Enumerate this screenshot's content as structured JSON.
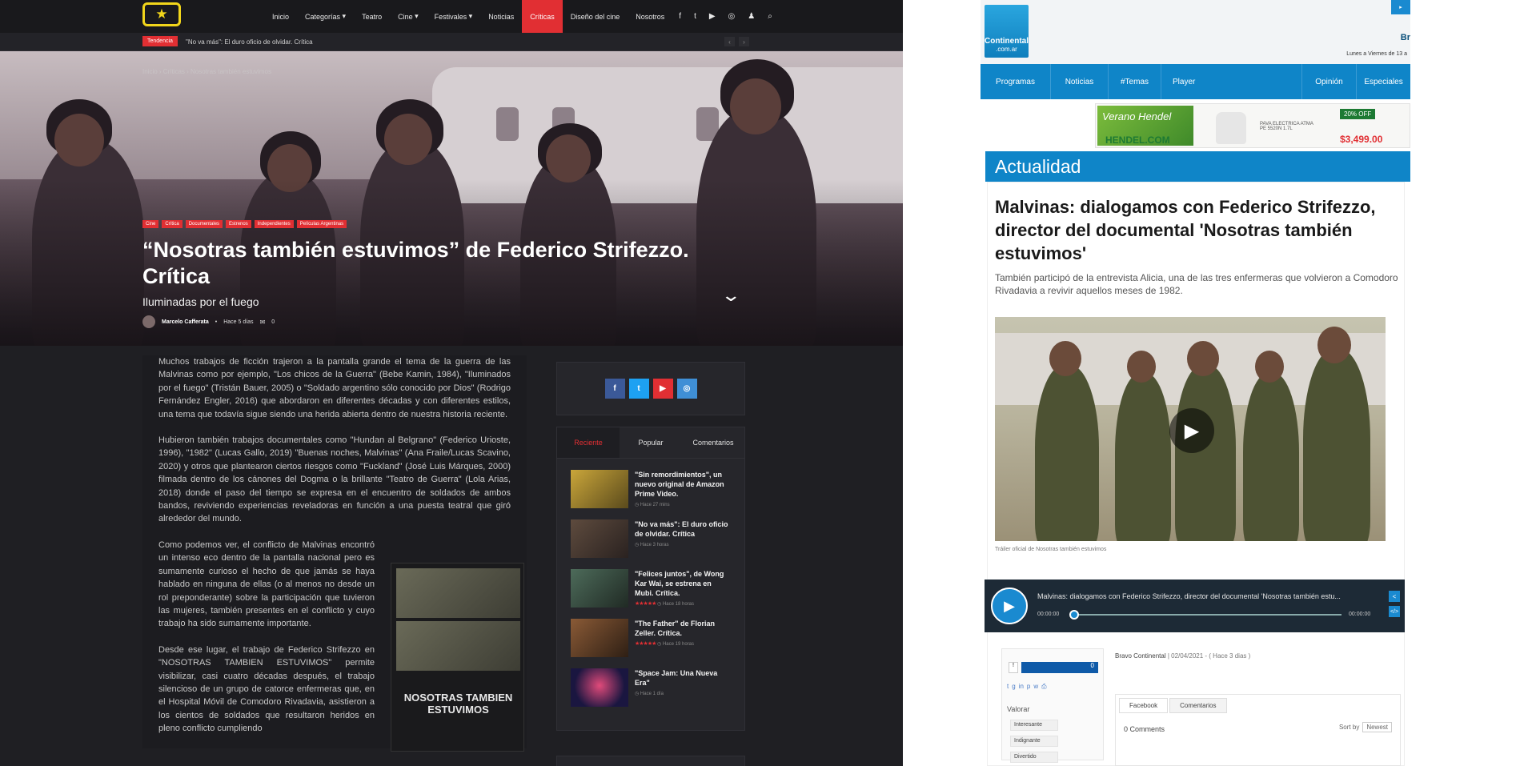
{
  "left_site": {
    "nav": {
      "logo_glyph": "★",
      "items": [
        "Inicio",
        "Categorías",
        "Teatro",
        "Cine",
        "Festivales",
        "Noticias",
        "Críticas",
        "Diseño del cine",
        "Nosotros"
      ],
      "active_item": "Críticas",
      "social_glyphs": [
        "f",
        "t",
        "▶",
        "◎",
        "♟",
        "⌕"
      ]
    },
    "ticker": {
      "label": "Tendencia",
      "text": "\"No va más\": El duro oficio de olvidar. Crítica",
      "prev": "‹",
      "next": "›"
    },
    "hero": {
      "breadcrumb": "Inicio › Críticas › Nosotras también estuvimos",
      "categories": [
        "Cine",
        "Crítica",
        "Documentales",
        "Estrenos",
        "Independientes",
        "Películas Argentinas"
      ],
      "title": "“Nosotras también estuvimos” de Federico Strifezzo. Crítica",
      "subtitle": "Iluminadas por el fuego",
      "author": "Marcelo Cafferata",
      "date": "Hace 5 días",
      "comments": "0",
      "chevron": "⌄"
    },
    "article": {
      "p1": "Muchos trabajos de ficción trajeron a la pantalla grande el tema de la guerra de las Malvinas como por ejemplo, \"Los chicos de la Guerra\" (Bebe Kamin, 1984), \"Iluminados por el fuego\" (Tristán Bauer, 2005) o \"Soldado argentino sólo conocido por Dios\" (Rodrigo Fernández Engler, 2016) que abordaron en diferentes décadas y con diferentes estilos, una tema que todavía sigue siendo una herida abierta dentro de nuestra historia reciente.",
      "p2": "Hubieron también trabajos documentales como \"Hundan al Belgrano\" (Federico Urioste, 1996), \"1982\" (Lucas Gallo, 2019) \"Buenas noches, Malvinas\" (Ana Fraile/Lucas Scavino, 2020) y otros que plantearon ciertos riesgos como \"Fuckland\" (José Luis Márques, 2000) filmada dentro de los cánones del Dogma o la brillante \"Teatro de Guerra\" (Lola Arias, 2018) donde el paso del tiempo se expresa en el encuentro de soldados de ambos bandos, reviviendo experiencias reveladoras en función a una puesta teatral que giró alrededor del mundo.",
      "p3": "Como podemos ver, el conflicto de Malvinas encontró un intenso eco dentro de la pantalla nacional pero es sumamente curioso el hecho de que jamás se haya hablado en ninguna de ellas (o al menos no desde un rol preponderante) sobre la participación que tuvieron las mujeres, también presentes en el conflicto y cuyo trabajo ha sido sumamente importante.",
      "p4": "Desde ese lugar, el trabajo de Federico Strifezzo en \"NOSOTRAS TAMBIEN ESTUVIMOS\" permite visibilizar, casi cuatro décadas después, el trabajo silencioso de un grupo de catorce enfermeras que, en el Hospital Móvil de Comodoro Rivadavia, asistieron a los cientos de soldados que resultaron heridos en pleno conflicto cumpliendo",
      "poster_title": "NOSOTRAS TAMBIEN ESTUVIMOS"
    },
    "sidebar": {
      "social": [
        "f",
        "t",
        "▶",
        "◎"
      ],
      "tabs": [
        "Reciente",
        "Popular",
        "Comentarios"
      ],
      "posts": [
        {
          "title": "\"Sin remordimientos\", un nuevo original de Amazon Prime Video.",
          "meta": "◷ Hace 27 mins",
          "stars": ""
        },
        {
          "title": "\"No va más\": El duro oficio de olvidar. Crítica",
          "meta": "◷ Hace 3 horas",
          "stars": ""
        },
        {
          "title": "\"Felices juntos\", de Wong Kar Wai, se estrena en Mubi. Crítica.",
          "meta": "◷ Hace 18 horas",
          "stars": "★★★★★"
        },
        {
          "title": "\"The Father\" de Florian Zeller. Crítica.",
          "meta": "◷ Hace 19 horas",
          "stars": "★★★★★"
        },
        {
          "title": "\"Space Jam: Una Nueva Era\"",
          "meta": "◷ Hace 1 día",
          "stars": ""
        }
      ]
    }
  },
  "right_site": {
    "logo": {
      "brand": "Continental",
      "domain": ".com.ar"
    },
    "header_button": "▸",
    "header_brand_text": "Br",
    "header_date": "Lunes a Viernes de 13 a",
    "nav": [
      "Programas",
      "Noticias",
      "#Temas",
      "Player",
      "Opinión",
      "Especiales"
    ],
    "ad": {
      "headline": "Verano Hendel",
      "brand": "HENDEL.COM",
      "discount": "20% OFF",
      "product": "PAVA ELECTRICA ATMA PE 5520N 1.7L",
      "price": "$3,499.00"
    },
    "section": "Actualidad",
    "title": "Malvinas: dialogamos con Federico Strifezzo, director del documental 'Nosotras también estuvimos'",
    "subtitle": "También participó de la entrevista Alicia, una de las tres enfermeras que volvieron a Comodoro Rivadavia a revivir aquellos meses de 1982.",
    "video_caption": "Tráiler oficial de Nosotras también estuvimos",
    "audio": {
      "title": "Malvinas: dialogamos con Federico Strifezzo, director del documental 'Nosotras también estu...",
      "time_current": "00:00:00",
      "time_total": "00:00:00",
      "progress": 0
    },
    "vote": {
      "count": "0",
      "label": "Valorar",
      "options": [
        "Interesante",
        "Indignante",
        "Divertido"
      ]
    },
    "source": "Bravo Continental",
    "date": "02/04/2021 - ( Hace 3 dias )",
    "comments_tabs": [
      "Facebook",
      "Comentarios"
    ],
    "comments_count": "0 Comments",
    "sort_label": "Sort by",
    "sort_value": "Newest"
  }
}
